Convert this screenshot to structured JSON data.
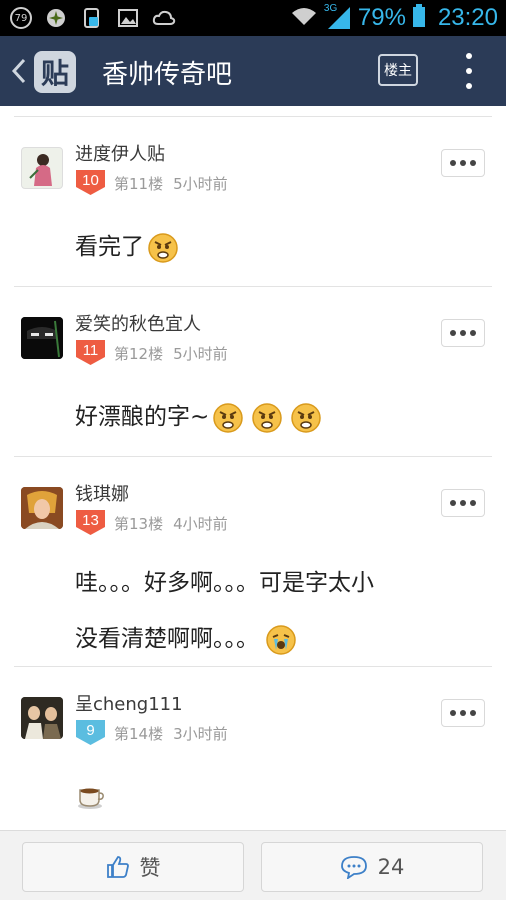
{
  "status_bar": {
    "badge": "79",
    "network": "3G",
    "battery_percent": "79%",
    "time": "23:20",
    "accent_color": "#37b7ea"
  },
  "header": {
    "logo_text": "贴",
    "title": "香帅传奇吧",
    "louzhu_label": "楼主"
  },
  "posts": [
    {
      "username": "进度伊人贴",
      "level": "10",
      "level_color": "#ee5c42",
      "floor": "第11楼",
      "time": "5小时前",
      "content": "看完了",
      "emoji": "angry-face-icon"
    },
    {
      "username": "爱笑的秋色宜人",
      "level": "11",
      "level_color": "#ee5c42",
      "floor": "第12楼",
      "time": "5小时前",
      "content": "好漂酿的字~",
      "emoji": "angry-face-icon"
    },
    {
      "username": "钱琪娜",
      "level": "13",
      "level_color": "#ee5c42",
      "floor": "第13楼",
      "time": "4小时前",
      "content_line1": "哇。。。好多啊。。。可是字太小",
      "content_line2": "没看清楚啊啊。。。",
      "emoji": "crying-face-icon"
    },
    {
      "username": "呈cheng111",
      "level": "9",
      "level_color": "#5bbde0",
      "floor": "第14楼",
      "time": "3小时前",
      "emoji": "coffee-cup-icon"
    }
  ],
  "bottom_bar": {
    "like_label": "赞",
    "comment_count": "24"
  }
}
